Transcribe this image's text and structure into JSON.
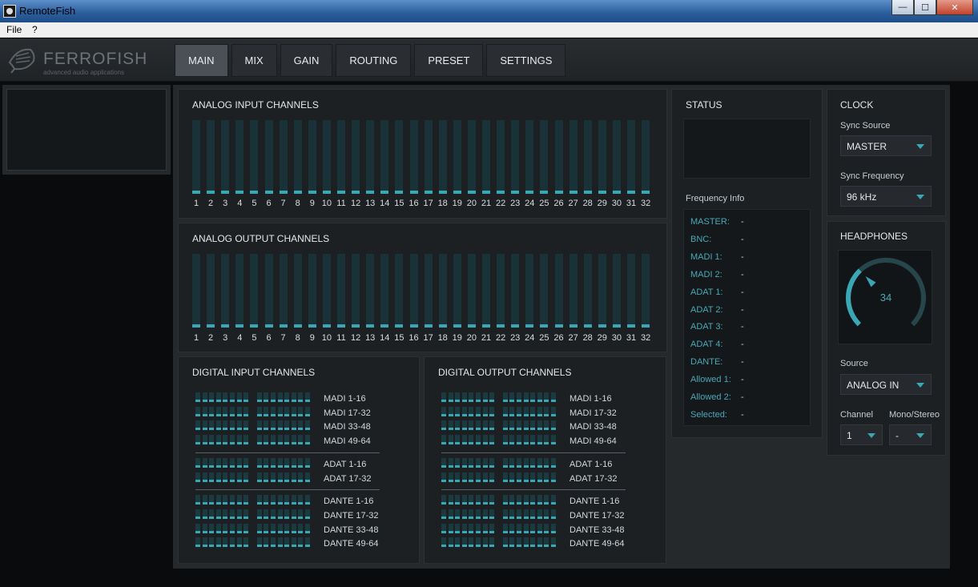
{
  "window": {
    "title": "RemoteFish",
    "min": "—",
    "max": "☐",
    "close": "✕"
  },
  "menu": {
    "file": "File",
    "help": "?"
  },
  "brand": {
    "name": "FERROFISH",
    "tagline": "advanced audio applications",
    "logo_icon": "fish-icon"
  },
  "tabs": [
    {
      "label": "MAIN",
      "active": true
    },
    {
      "label": "MIX"
    },
    {
      "label": "GAIN"
    },
    {
      "label": "ROUTING"
    },
    {
      "label": "PRESET"
    },
    {
      "label": "SETTINGS"
    }
  ],
  "analog_input": {
    "title": "ANALOG INPUT CHANNELS",
    "channels": [
      "1",
      "2",
      "3",
      "4",
      "5",
      "6",
      "7",
      "8",
      "9",
      "10",
      "11",
      "12",
      "13",
      "14",
      "15",
      "16",
      "17",
      "18",
      "19",
      "20",
      "21",
      "22",
      "23",
      "24",
      "25",
      "26",
      "27",
      "28",
      "29",
      "30",
      "31",
      "32"
    ]
  },
  "analog_output": {
    "title": "ANALOG OUTPUT CHANNELS",
    "channels": [
      "1",
      "2",
      "3",
      "4",
      "5",
      "6",
      "7",
      "8",
      "9",
      "10",
      "11",
      "12",
      "13",
      "14",
      "15",
      "16",
      "17",
      "18",
      "19",
      "20",
      "21",
      "22",
      "23",
      "24",
      "25",
      "26",
      "27",
      "28",
      "29",
      "30",
      "31",
      "32"
    ]
  },
  "digital_input": {
    "title": "DIGITAL INPUT CHANNELS",
    "groups": [
      [
        "MADI 1-16",
        "MADI 17-32",
        "MADI 33-48",
        "MADI 49-64"
      ],
      [
        "ADAT 1-16",
        "ADAT 17-32"
      ],
      [
        "DANTE 1-16",
        "DANTE 17-32",
        "DANTE 33-48",
        "DANTE 49-64"
      ]
    ]
  },
  "digital_output": {
    "title": "DIGITAL OUTPUT CHANNELS",
    "groups": [
      [
        "MADI 1-16",
        "MADI 17-32",
        "MADI 33-48",
        "MADI 49-64"
      ],
      [
        "ADAT 1-16",
        "ADAT 17-32"
      ],
      [
        "DANTE 1-16",
        "DANTE 17-32",
        "DANTE 33-48",
        "DANTE 49-64"
      ]
    ]
  },
  "status": {
    "title": "STATUS",
    "freq_title": "Frequency Info",
    "items": [
      {
        "key": "MASTER:",
        "value": "-"
      },
      {
        "key": "BNC:",
        "value": "-"
      },
      {
        "key": "MADI 1:",
        "value": "-"
      },
      {
        "key": "MADI 2:",
        "value": "-"
      },
      {
        "key": "ADAT 1:",
        "value": "-"
      },
      {
        "key": "ADAT 2:",
        "value": "-"
      },
      {
        "key": "ADAT 3:",
        "value": "-"
      },
      {
        "key": "ADAT 4:",
        "value": "-"
      },
      {
        "key": "DANTE:",
        "value": "-"
      },
      {
        "key": "Allowed 1:",
        "value": "-"
      },
      {
        "key": "Allowed 2:",
        "value": "-"
      },
      {
        "key": "Selected:",
        "value": "-"
      }
    ]
  },
  "clock": {
    "title": "CLOCK",
    "sync_source_label": "Sync Source",
    "sync_source": "MASTER",
    "sync_freq_label": "Sync Frequency",
    "sync_freq": "96 kHz"
  },
  "headphones": {
    "title": "HEADPHONES",
    "level": 34,
    "level_fraction": 0.34,
    "source_label": "Source",
    "source": "ANALOG IN",
    "channel_label": "Channel",
    "channel": "1",
    "mono_label": "Mono/Stereo",
    "mono": "-"
  },
  "colors": {
    "accent": "#3aa8b4",
    "panel": "#1c2023",
    "background": "#0a0b0c"
  }
}
